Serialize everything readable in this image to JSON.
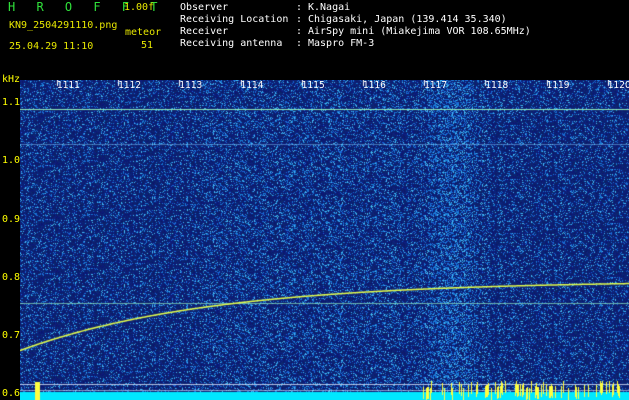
{
  "header": {
    "app_title": "H R O F F T",
    "version": "1.00f",
    "filename": "KN9_2504291110.png",
    "meteor_label": "meteor",
    "datetime": "25.04.29 11:10",
    "meteor_count": "51"
  },
  "info": [
    {
      "key": "Observer",
      "sep": ":",
      "value": "K.Nagai"
    },
    {
      "key": "Receiving Location",
      "sep": ":",
      "value": "Chigasaki, Japan (139.414 35.340)"
    },
    {
      "key": "Receiver",
      "sep": ":",
      "value": "AirSpy mini (Miakejima VOR 108.65MHz)"
    },
    {
      "key": "Receiving antenna",
      "sep": ":",
      "value": "Maspro FM-3"
    }
  ],
  "spectrogram": {
    "y_unit": "kHz",
    "time_ticks": [
      "1111",
      "1112",
      "1113",
      "1114",
      "1115",
      "1116",
      "1117",
      "1118",
      "1119",
      "1120"
    ],
    "freq_ticks": [
      "1.1",
      "1.0",
      "0.9",
      "0.8",
      "0.7",
      "0.6"
    ],
    "freq_range": [
      0.59,
      1.14
    ],
    "colors": {
      "background": "#0a1a6e",
      "noise_light": "#37b0f0",
      "noise_mid": "#1e5fd2",
      "signal": "#e6ff4a",
      "tick_x": "#ffffff",
      "tick_y": "#ffff00",
      "bottom_bar": "#00e8ff"
    }
  }
}
